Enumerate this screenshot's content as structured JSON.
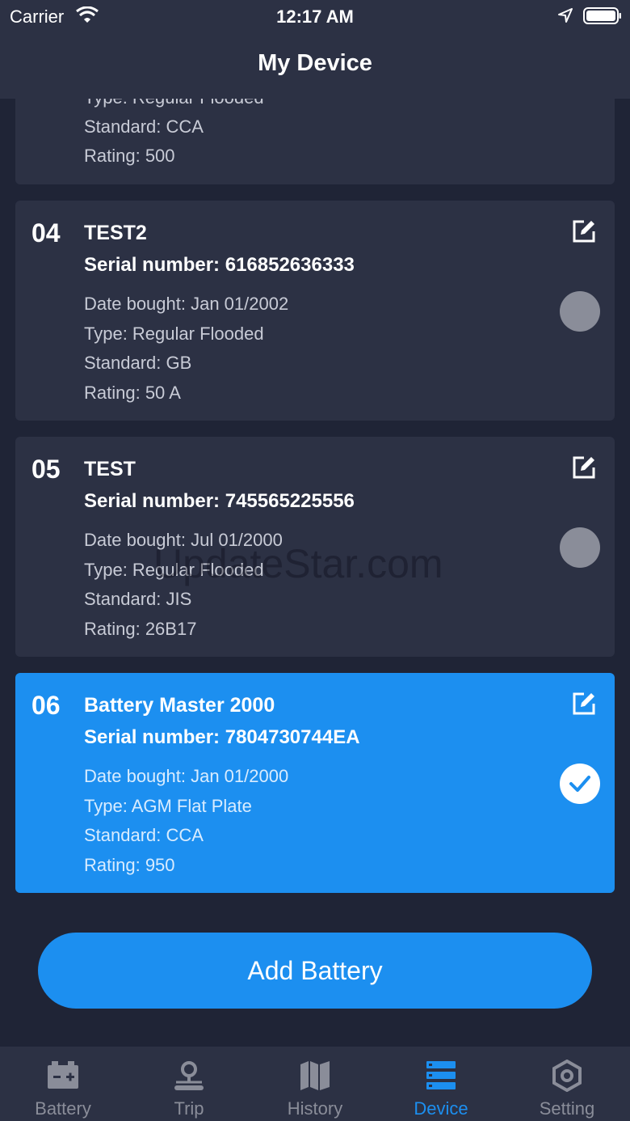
{
  "status": {
    "carrier": "Carrier",
    "time": "12:17 AM"
  },
  "nav": {
    "title": "My Device"
  },
  "partial_card": {
    "type": "Type: Regular Flooded",
    "standard": "Standard: CCA",
    "rating": "Rating: 500"
  },
  "cards": [
    {
      "num": "04",
      "name": "TEST2",
      "serial": "Serial number: 616852636333",
      "date": "Date bought: Jan 01/2002",
      "type": "Type: Regular Flooded",
      "standard": "Standard: GB",
      "rating": "Rating: 50 A",
      "selected": false
    },
    {
      "num": "05",
      "name": "TEST",
      "serial": "Serial number: 745565225556",
      "date": "Date bought: Jul 01/2000",
      "type": "Type: Regular Flooded",
      "standard": "Standard: JIS",
      "rating": "Rating: 26B17",
      "selected": false
    },
    {
      "num": "06",
      "name": "Battery Master 2000",
      "serial": "Serial number: 7804730744EA",
      "date": "Date bought: Jan 01/2000",
      "type": "Type: AGM Flat Plate",
      "standard": "Standard: CCA",
      "rating": "Rating: 950",
      "selected": true
    }
  ],
  "add_button": {
    "label": "Add Battery"
  },
  "tabs": [
    {
      "label": "Battery",
      "icon": "battery-icon"
    },
    {
      "label": "Trip",
      "icon": "trip-pin-icon"
    },
    {
      "label": "History",
      "icon": "history-book-icon"
    },
    {
      "label": "Device",
      "icon": "device-list-icon",
      "active": true
    },
    {
      "label": "Setting",
      "icon": "setting-hex-icon"
    }
  ],
  "watermark": "UpdateStar.com",
  "colors": {
    "accent": "#1c8ff0",
    "card": "#2c3144",
    "background": "#1f2436",
    "inactive": "#8a8d99"
  }
}
